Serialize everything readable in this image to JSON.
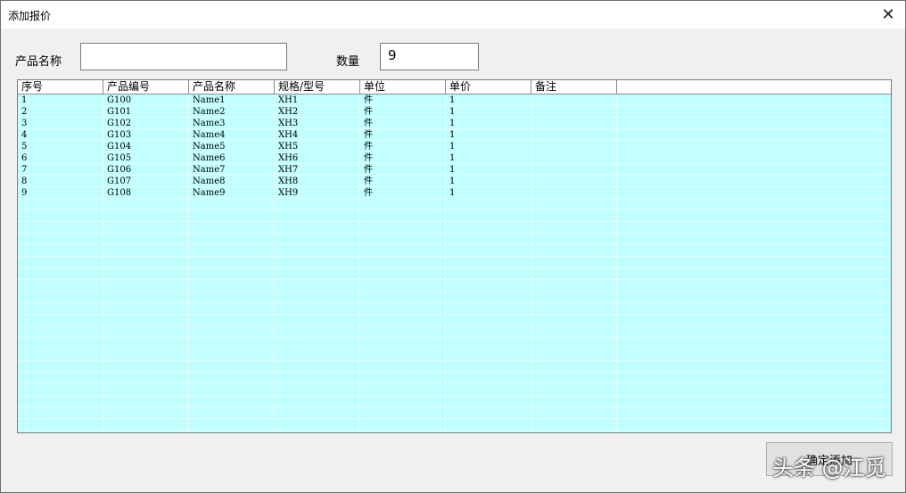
{
  "window": {
    "title": "添加报价",
    "close_glyph": "✕"
  },
  "form": {
    "product_name_label": "产品名称",
    "product_name_value": "",
    "quantity_label": "数量",
    "quantity_value": "9"
  },
  "table": {
    "columns": [
      "序号",
      "产品编号",
      "产品名称",
      "规格/型号",
      "单位",
      "单价",
      "备注"
    ],
    "rows": [
      [
        "1",
        "G100",
        "Name1",
        "XH1",
        "件",
        "1",
        ""
      ],
      [
        "2",
        "G101",
        "Name2",
        "XH2",
        "件",
        "1",
        ""
      ],
      [
        "3",
        "G102",
        "Name3",
        "XH3",
        "件",
        "1",
        ""
      ],
      [
        "4",
        "G103",
        "Name4",
        "XH4",
        "件",
        "1",
        ""
      ],
      [
        "5",
        "G104",
        "Name5",
        "XH5",
        "件",
        "1",
        ""
      ],
      [
        "6",
        "G105",
        "Name6",
        "XH6",
        "件",
        "1",
        ""
      ],
      [
        "7",
        "G106",
        "Name7",
        "XH7",
        "件",
        "1",
        ""
      ],
      [
        "8",
        "G107",
        "Name8",
        "XH8",
        "件",
        "1",
        ""
      ],
      [
        "9",
        "G108",
        "Name9",
        "XH9",
        "件",
        "1",
        ""
      ]
    ]
  },
  "buttons": {
    "confirm_add": "确定添加"
  },
  "watermark": "头条 @江觅",
  "colors": {
    "grid_background": "#c2ffff",
    "title_bar": "#ffffff",
    "dialog_background": "#f0f0f0"
  }
}
